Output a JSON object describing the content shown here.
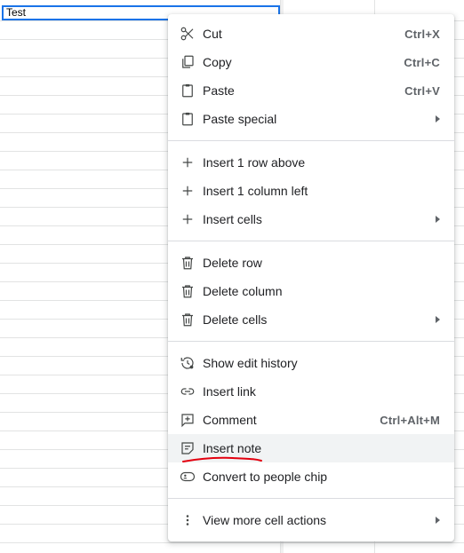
{
  "cell": {
    "value": "Test"
  },
  "menu": {
    "groups": [
      [
        {
          "label": "Cut",
          "shortcut": "Ctrl+X",
          "icon": "scissors-icon"
        },
        {
          "label": "Copy",
          "shortcut": "Ctrl+C",
          "icon": "copy-icon"
        },
        {
          "label": "Paste",
          "shortcut": "Ctrl+V",
          "icon": "clipboard-icon"
        },
        {
          "label": "Paste special",
          "submenu": true,
          "icon": "clipboard-icon"
        }
      ],
      [
        {
          "label": "Insert 1 row above",
          "icon": "plus-icon"
        },
        {
          "label": "Insert 1 column left",
          "icon": "plus-icon"
        },
        {
          "label": "Insert cells",
          "submenu": true,
          "icon": "plus-icon"
        }
      ],
      [
        {
          "label": "Delete row",
          "icon": "trash-icon"
        },
        {
          "label": "Delete column",
          "icon": "trash-icon"
        },
        {
          "label": "Delete cells",
          "submenu": true,
          "icon": "trash-icon"
        }
      ],
      [
        {
          "label": "Show edit history",
          "icon": "history-icon"
        },
        {
          "label": "Insert link",
          "icon": "link-icon"
        },
        {
          "label": "Comment",
          "shortcut": "Ctrl+Alt+M",
          "icon": "comment-icon"
        },
        {
          "label": "Insert note",
          "icon": "note-icon",
          "highlighted": true
        },
        {
          "label": "Convert to people chip",
          "icon": "person-chip-icon"
        }
      ],
      [
        {
          "label": "View more cell actions",
          "submenu": true,
          "icon": "more-vert-icon"
        }
      ]
    ]
  },
  "colors": {
    "hover": "#f1f3f4",
    "selection": "#1a73e8",
    "annotation": "#e3000f"
  }
}
